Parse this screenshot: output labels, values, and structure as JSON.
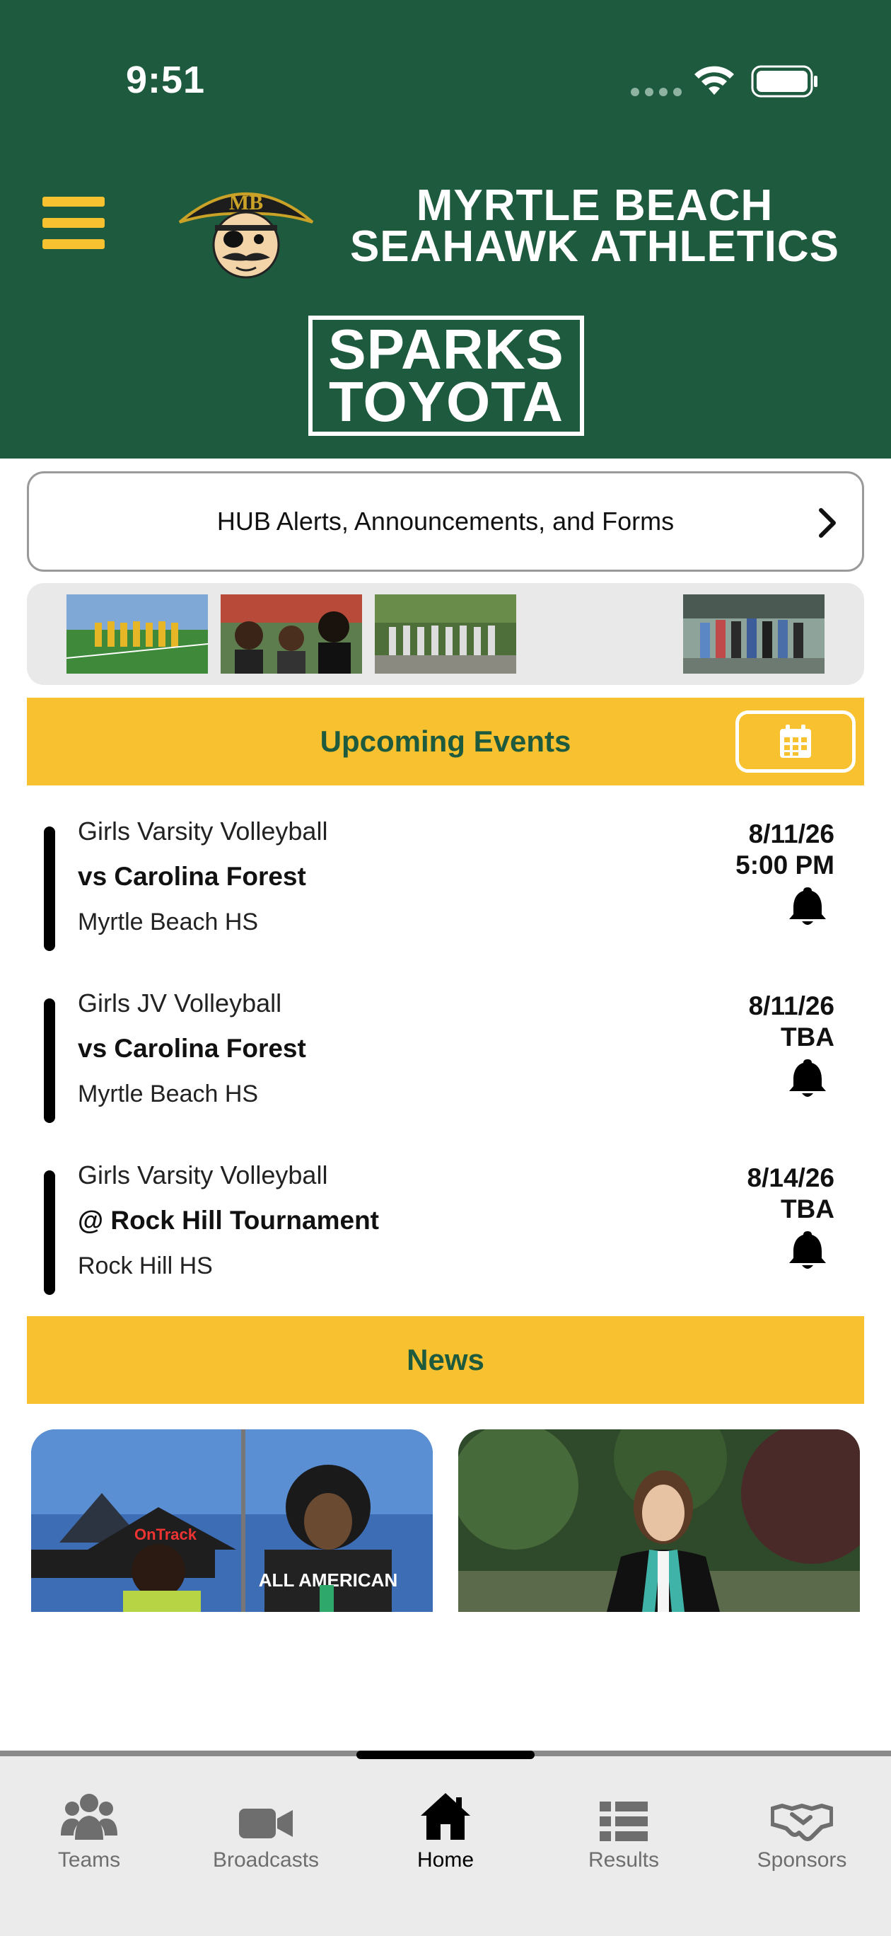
{
  "status_bar": {
    "time": "9:51"
  },
  "header": {
    "brand_line1": "MYRTLE BEACH",
    "brand_line2": "SEAHAWK ATHLETICS",
    "logo_letters": "MB",
    "sponsor_line1": "SPARKS",
    "sponsor_line2": "TOYOTA"
  },
  "alerts": {
    "label": "HUB Alerts, Announcements, and Forms"
  },
  "upcoming": {
    "title": "Upcoming Events",
    "events": [
      {
        "team": "Girls Varsity Volleyball",
        "opponent": "vs Carolina Forest",
        "venue": "Myrtle Beach HS",
        "date": "8/11/26",
        "time": "5:00 PM"
      },
      {
        "team": "Girls JV Volleyball",
        "opponent": "vs Carolina Forest",
        "venue": "Myrtle Beach HS",
        "date": "8/11/26",
        "time": "TBA"
      },
      {
        "team": "Girls Varsity Volleyball",
        "opponent": "@ Rock Hill Tournament",
        "venue": "Rock Hill HS",
        "date": "8/14/26",
        "time": "TBA"
      }
    ]
  },
  "news": {
    "title": "News",
    "card1_banner": "OnTrack",
    "card1_shirt": "ALL AMERICAN"
  },
  "tabs": [
    {
      "label": "Teams",
      "icon": "people-icon"
    },
    {
      "label": "Broadcasts",
      "icon": "video-camera-icon"
    },
    {
      "label": "Home",
      "icon": "home-icon"
    },
    {
      "label": "Results",
      "icon": "list-icon"
    },
    {
      "label": "Sponsors",
      "icon": "handshake-icon"
    }
  ],
  "colors": {
    "header_green": "#1e5a3d",
    "accent_gold": "#f7c12f",
    "tab_bar": "#ebebeb"
  }
}
